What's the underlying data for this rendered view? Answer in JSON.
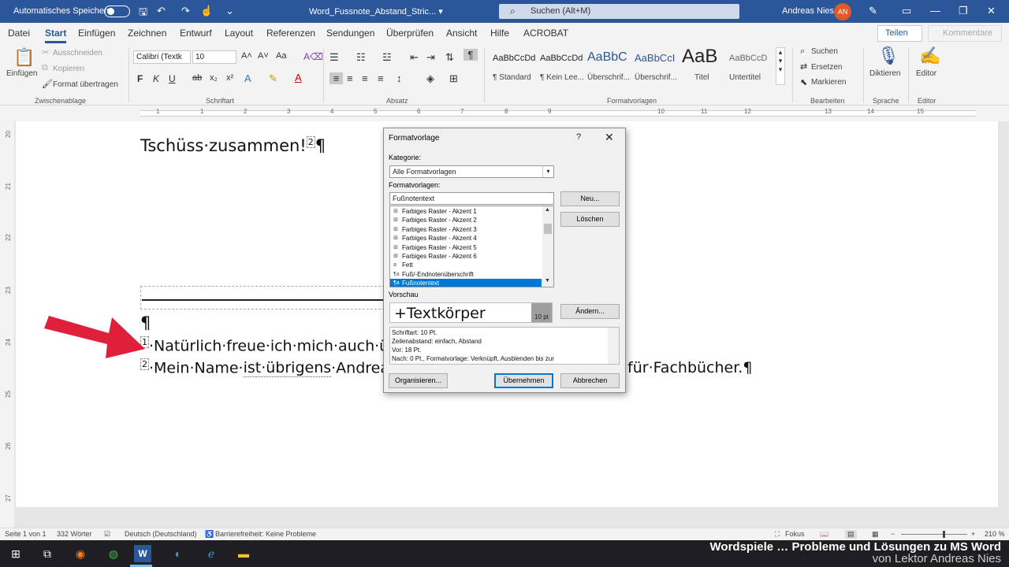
{
  "titlebar": {
    "autosave_label": "Automatisches Speichern",
    "doc_title": "Word_Fussnote_Abstand_Stric... ▾",
    "search_placeholder": "Suchen (Alt+M)",
    "user_name": "Andreas Nies",
    "user_initials": "AN"
  },
  "menu": {
    "tabs": [
      "Datei",
      "Start",
      "Einfügen",
      "Zeichnen",
      "Entwurf",
      "Layout",
      "Referenzen",
      "Sendungen",
      "Überprüfen",
      "Ansicht",
      "Hilfe",
      "ACROBAT"
    ],
    "active_tab": "Start",
    "share_label": "Teilen",
    "comments_label": "Kommentare"
  },
  "ribbon": {
    "clipboard": {
      "paste": "Einfügen",
      "cut": "Ausschneiden",
      "copy": "Kopieren",
      "format_painter": "Format übertragen",
      "group_label": "Zwischenablage"
    },
    "font": {
      "font_name": "Calibri (Textk",
      "font_size": "10",
      "group_label": "Schriftart"
    },
    "paragraph": {
      "group_label": "Absatz"
    },
    "styles": {
      "items": [
        {
          "sample": "AaBbCcDd",
          "name": "¶ Standard"
        },
        {
          "sample": "AaBbCcDd",
          "name": "¶ Kein Lee..."
        },
        {
          "sample": "AaBbC",
          "name": "Überschrif..."
        },
        {
          "sample": "AaBbCcI",
          "name": "Überschrif..."
        },
        {
          "sample": "AaB",
          "name": "Titel"
        },
        {
          "sample": "AaBbCcD",
          "name": "Untertitel"
        }
      ],
      "group_label": "Formatvorlagen"
    },
    "editing": {
      "find": "Suchen",
      "replace": "Ersetzen",
      "select": "Markieren",
      "group_label": "Bearbeiten"
    },
    "voice": {
      "dictate": "Diktieren",
      "group_label": "Sprache"
    },
    "editor": {
      "label": "Editor",
      "group_label": "Editor"
    }
  },
  "ruler": {
    "h_numbers": [
      "1",
      "1",
      "2",
      "3",
      "4",
      "5",
      "6",
      "7",
      "8",
      "9",
      "10",
      "11",
      "12",
      "13",
      "14",
      "15"
    ],
    "v_numbers": [
      "20",
      "21",
      "22",
      "23",
      "24",
      "25",
      "26",
      "27"
    ]
  },
  "document": {
    "line1_text": "Tschüss·zusammen!",
    "line1_ref": "2",
    "line1_mark": "¶",
    "para_mark": "¶",
    "fn1_ref": "1",
    "fn1_text": "·Natürlich·freue·ich·mich·auch·ü",
    "fn2_ref": "2",
    "fn2_start": "·Mein·Name·",
    "fn2_dotted": "ist·übrigens",
    "fn2_mid": "·Andrea",
    "fn2_end": "·für·Fachbücher.¶"
  },
  "dialog": {
    "title": "Formatvorlage",
    "help": "?",
    "close": "✕",
    "category_label": "Kategorie:",
    "category_value": "Alle Formatvorlagen",
    "styles_label": "Formatvorlagen:",
    "style_input": "Fußnotentext",
    "style_list": [
      {
        "glyph": "⊞",
        "name": "Farbiges Raster - Akzent 1"
      },
      {
        "glyph": "⊞",
        "name": "Farbiges Raster - Akzent 2"
      },
      {
        "glyph": "⊞",
        "name": "Farbiges Raster - Akzent 3"
      },
      {
        "glyph": "⊞",
        "name": "Farbiges Raster - Akzent 4"
      },
      {
        "glyph": "⊞",
        "name": "Farbiges Raster - Akzent 5"
      },
      {
        "glyph": "⊞",
        "name": "Farbiges Raster - Akzent 6"
      },
      {
        "glyph": "a",
        "name": "Fett"
      },
      {
        "glyph": "¶a",
        "name": "Fuß/-Endnotenüberschrift"
      },
      {
        "glyph": "¶a",
        "name": "Fußnotentext"
      }
    ],
    "selected_style": "Fußnotentext",
    "new_button": "Neu...",
    "delete_button": "Löschen",
    "preview_label": "Vorschau",
    "preview_text": "+Textkörper",
    "preview_size": "10 pt",
    "modify_button": "Ändern...",
    "description_lines": [
      "Schriftart: 10 Pt.",
      "    Zeilenabstand:  einfach, Abstand",
      "    Vor:  18 Pt.",
      "    Nach:  0 Pt., Formatvorlage: Verknüpft, Ausblenden bis zur"
    ],
    "organize_button": "Organisieren...",
    "apply_button": "Übernehmen",
    "cancel_button": "Abbrechen"
  },
  "statusbar": {
    "page": "Seite 1 von 1",
    "words": "332 Wörter",
    "language": "Deutsch (Deutschland)",
    "accessibility": "Barrierefreiheit: Keine Probleme",
    "focus": "Fokus",
    "zoom": "210 %"
  },
  "watermark": {
    "line1": "Wordspiele … Probleme und Lösungen zu MS Word",
    "line2": "von Lektor Andreas Nies"
  },
  "colors": {
    "accent": "#2b579a",
    "arrow": "#e0203a",
    "selection": "#0078d7"
  }
}
